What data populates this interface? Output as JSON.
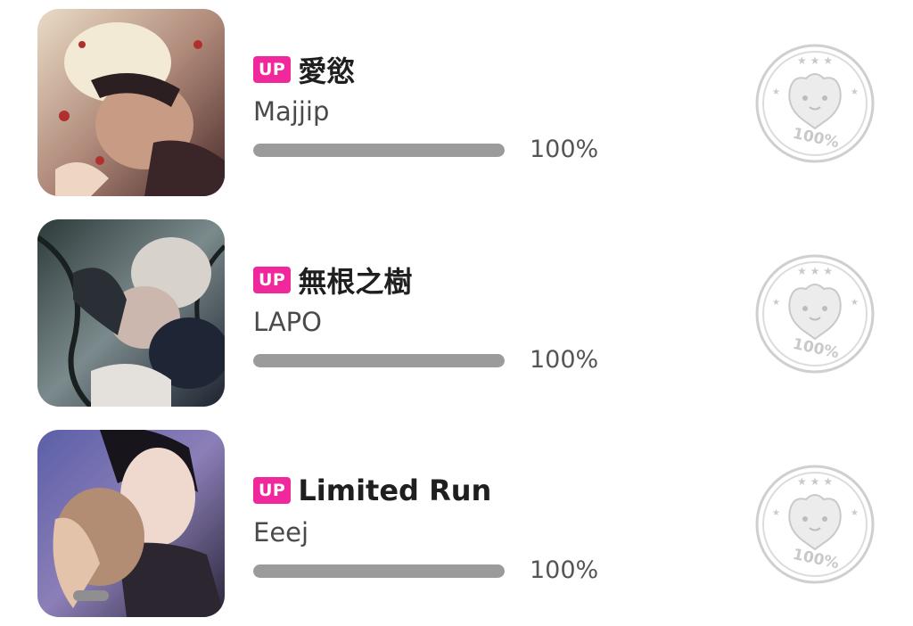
{
  "items": [
    {
      "badge": "UP",
      "title": "愛慾",
      "author": "Majjip",
      "progress": 1.0,
      "progress_text": "100%",
      "stamp_text": "100%",
      "cover_icon": "cover-image-majjip",
      "stamp_icon": "completion-stamp-icon"
    },
    {
      "badge": "UP",
      "title": "無根之樹",
      "author": "LAPO",
      "progress": 1.0,
      "progress_text": "100%",
      "stamp_text": "100%",
      "cover_icon": "cover-image-lapo",
      "stamp_icon": "completion-stamp-icon"
    },
    {
      "badge": "UP",
      "title": "Limited Run",
      "author": "Eeej",
      "progress": 1.0,
      "progress_text": "100%",
      "stamp_text": "100%",
      "cover_icon": "cover-image-eeej",
      "stamp_icon": "completion-stamp-icon"
    }
  ],
  "colors": {
    "badge_bg": "#f0289b",
    "progress_fill": "#9b9b9b",
    "progress_track": "#e6e6e6",
    "stamp": "#c9c9c9"
  }
}
